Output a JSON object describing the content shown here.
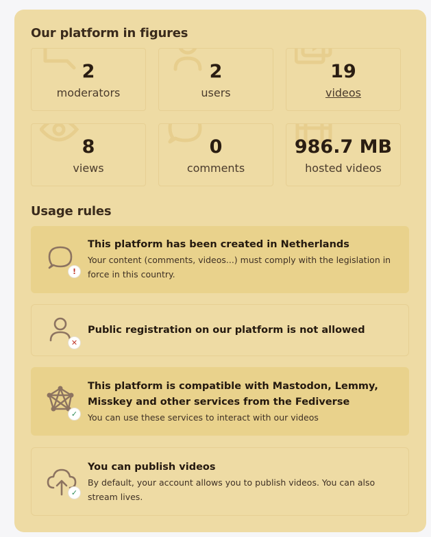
{
  "figures_section": {
    "title": "Our platform in figures",
    "items": [
      {
        "value": "2",
        "label": "moderators",
        "icon": "megaphone-icon"
      },
      {
        "value": "2",
        "label": "users",
        "icon": "user-icon"
      },
      {
        "value": "19",
        "label": "videos",
        "icon": "videos-icon"
      },
      {
        "value": "8",
        "label": "views",
        "icon": "eye-icon"
      },
      {
        "value": "0",
        "label": "comments",
        "icon": "comment-icon"
      },
      {
        "value": "986.7 MB",
        "label": "hosted videos",
        "icon": "film-icon"
      }
    ]
  },
  "rules_section": {
    "title": "Usage rules",
    "rules": [
      {
        "title": "This platform has been created in Netherlands",
        "description": "Your content (comments, videos...) must comply with the legislation in force in this country.",
        "icon": "comment-icon",
        "badge": "!"
      },
      {
        "title": "Public registration on our platform is not allowed",
        "icon": "user-icon",
        "badge": "✕"
      },
      {
        "title": "This platform is compatible with Mastodon, Lemmy, Misskey and other services from the Fediverse",
        "description": "You can use these services to interact with our videos",
        "icon": "fediverse-icon",
        "badge": "✓"
      },
      {
        "title": "You can publish videos",
        "description": "By default, your account allows you to publish videos. You can also stream lives.",
        "icon": "cloud-upload-icon",
        "badge": "✓"
      }
    ]
  },
  "colors": {
    "panel": "#eedba4",
    "highlight": "#e9d28c",
    "icon": "#8c7360",
    "badge_error": "#c0392b",
    "badge_success": "#2e8b57"
  }
}
